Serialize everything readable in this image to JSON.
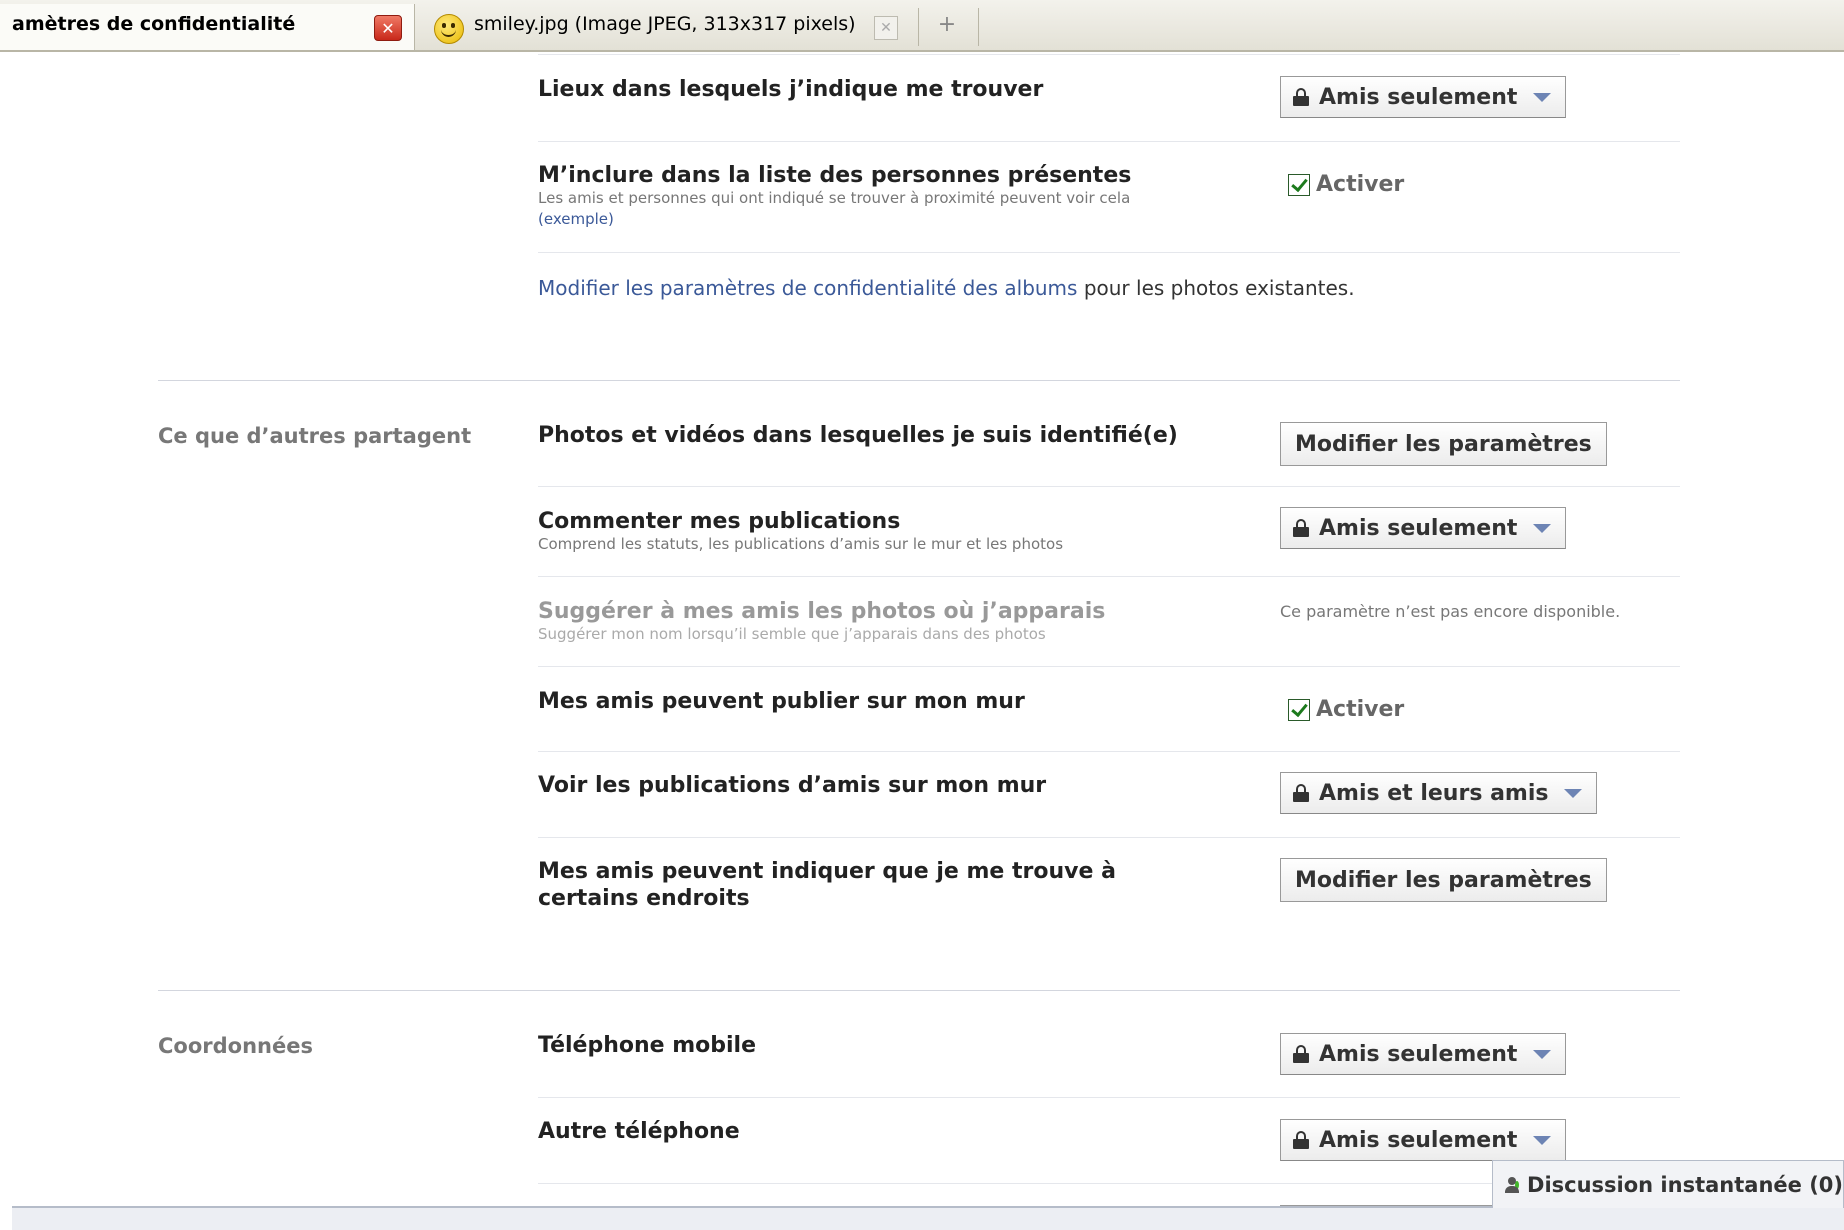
{
  "browser": {
    "active_tab_title": "amètres de confidentialité",
    "second_tab_title": "smiley.jpg (Image JPEG, 313x317 pixels)",
    "close_glyph": "✕",
    "new_tab_glyph": "+"
  },
  "top_section": {
    "rows": [
      {
        "title": "Lieux dans lesquels j’indique me trouver",
        "control": "Amis seulement"
      },
      {
        "title": "M’inclure dans la liste des personnes présentes",
        "desc": "Les amis et personnes qui ont indiqué se trouver à proximité peuvent voir cela",
        "link": "(exemple)",
        "control": "Activer",
        "checked": true
      }
    ],
    "album_link": "Modifier les paramètres de confidentialité des albums",
    "album_suffix": " pour les photos existantes."
  },
  "others_share": {
    "label": "Ce que d’autres partagent",
    "rows": [
      {
        "title": "Photos et vidéos dans lesquelles je suis identifié(e)",
        "control": "Modifier les paramètres"
      },
      {
        "title": "Commenter mes publications",
        "desc": "Comprend les statuts, les publications d’amis sur le mur et les photos",
        "control": "Amis seulement"
      },
      {
        "title": "Suggérer à mes amis les photos où j’apparais",
        "desc": "Suggérer mon nom lorsqu’il semble que j’apparais dans des photos",
        "control": "Ce paramètre n’est pas encore disponible."
      },
      {
        "title": "Mes amis peuvent publier sur mon mur",
        "control": "Activer",
        "checked": true
      },
      {
        "title": "Voir les publications d’amis sur mon mur",
        "control": "Amis et leurs amis"
      },
      {
        "title": "Mes amis peuvent indiquer que je me trouve à certains endroits",
        "control": "Modifier les paramètres"
      }
    ]
  },
  "contact": {
    "label": "Coordonnées",
    "rows": [
      {
        "title": "Téléphone mobile",
        "control": "Amis seulement"
      },
      {
        "title": "Autre téléphone",
        "control": "Amis seulement"
      }
    ]
  },
  "chat": {
    "label": "Discussion instantanée (0)"
  },
  "colors": {
    "link": "#3b5998",
    "caret": "#6d84b4",
    "online": "#42b72a"
  }
}
